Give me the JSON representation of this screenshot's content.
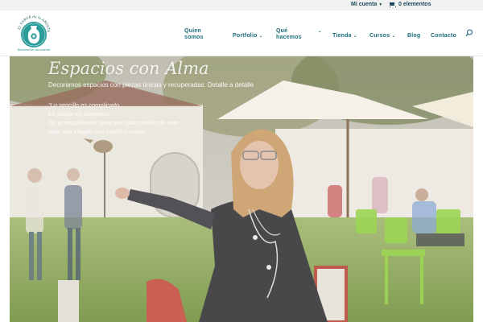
{
  "topbar": {
    "account_label": "Mi cuenta",
    "cart_label": "0 elementos"
  },
  "logo": {
    "top_text": "El SABOR de la AMISTAD",
    "bottom_text": "Decoración consciente"
  },
  "nav": {
    "items": [
      {
        "label_1": "Quien",
        "label_2": "somos",
        "has_submenu": false
      },
      {
        "label_1": "Portfolio",
        "has_submenu": true
      },
      {
        "label_1": "Qué",
        "label_2": "hacemos",
        "has_submenu": true
      },
      {
        "label_1": "Tienda",
        "has_submenu": true
      },
      {
        "label_1": "Cursos",
        "has_submenu": true
      },
      {
        "label_1": "Blog",
        "has_submenu": false
      },
      {
        "label_1": "Contacto",
        "has_submenu": false
      }
    ],
    "search_icon": "search-icon"
  },
  "hero": {
    "title": "Espacios con Alma",
    "subtitle": "Decoramos espacios con piezas únicas y recuperadas. Detalle a detalle",
    "quotes": [
      "\"Lo sencillo es complicado,",
      "Lo simple es completo\"",
      "Os acompañamos para que cada detalle de este",
      "viaje sea elegido con cariño y mimo."
    ]
  },
  "colors": {
    "nav_text": "#1b6b7a",
    "logo_teal": "#1a8a8a",
    "topbar_bg": "#f1f1f1"
  }
}
